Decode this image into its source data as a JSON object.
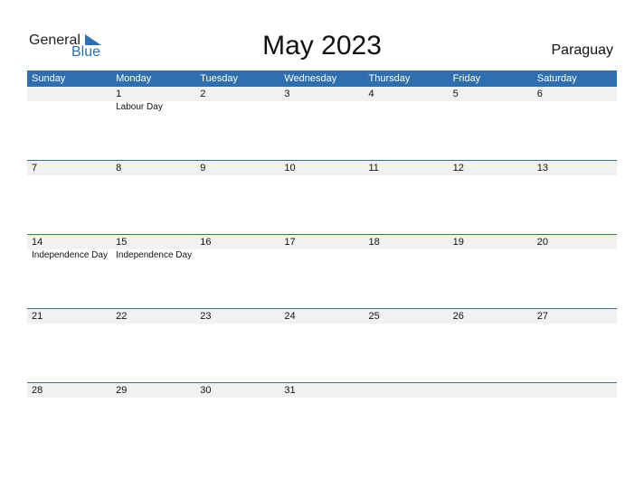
{
  "logo": {
    "general": "General",
    "blue": "Blue"
  },
  "title": "May 2023",
  "country": "Paraguay",
  "weekdays": [
    "Sunday",
    "Monday",
    "Tuesday",
    "Wednesday",
    "Thursday",
    "Friday",
    "Saturday"
  ],
  "weeks": [
    {
      "days": [
        "",
        "1",
        "2",
        "3",
        "4",
        "5",
        "6"
      ],
      "events": [
        "",
        "Labour Day",
        "",
        "",
        "",
        "",
        ""
      ]
    },
    {
      "days": [
        "7",
        "8",
        "9",
        "10",
        "11",
        "12",
        "13"
      ],
      "events": [
        "",
        "",
        "",
        "",
        "",
        "",
        ""
      ]
    },
    {
      "days": [
        "14",
        "15",
        "16",
        "17",
        "18",
        "19",
        "20"
      ],
      "events": [
        "Independence Day",
        "Independence Day",
        "",
        "",
        "",
        "",
        ""
      ]
    },
    {
      "days": [
        "21",
        "22",
        "23",
        "24",
        "25",
        "26",
        "27"
      ],
      "events": [
        "",
        "",
        "",
        "",
        "",
        "",
        ""
      ]
    },
    {
      "days": [
        "28",
        "29",
        "30",
        "31",
        "",
        "",
        ""
      ],
      "events": [
        "",
        "",
        "",
        "",
        "",
        "",
        ""
      ]
    }
  ],
  "colors": {
    "accent": "#2e6fb0",
    "band": "#f1f1f1"
  }
}
